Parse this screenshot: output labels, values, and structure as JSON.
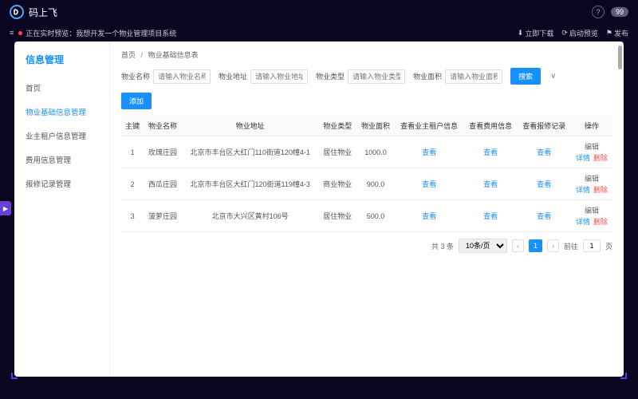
{
  "header": {
    "app_name": "码上飞",
    "help_glyph": "?",
    "user_badge": "99"
  },
  "subheader": {
    "menu_glyph": "≡",
    "live_label": "正在实时预览：",
    "live_text": "我想开发一个物业管理项目系统",
    "download": "立即下载",
    "preview": "启动预览",
    "publish": "发布"
  },
  "side_expand_glyph": "▶",
  "sidebar": {
    "title": "信息管理",
    "items": [
      "首页",
      "物业基础信息管理",
      "业主租户信息管理",
      "费用信息管理",
      "报修记录管理"
    ],
    "active_index": 1
  },
  "breadcrumb": {
    "home": "首页",
    "current": "物业基础信息表"
  },
  "filters": {
    "name_label": "物业名称",
    "name_ph": "请输入物业名称",
    "addr_label": "物业地址",
    "addr_ph": "请输入物业地址",
    "type_label": "物业类型",
    "type_ph": "请输入物业类型",
    "area_label": "物业面积",
    "area_ph": "请输入物业面积",
    "search_btn": "搜索",
    "expand_glyph": "∨"
  },
  "add_btn": "添加",
  "table": {
    "headers": [
      "主键",
      "物业名称",
      "物业地址",
      "物业类型",
      "物业面积",
      "查看业主租户信息",
      "查看费用信息",
      "查看报修记录",
      "操作"
    ],
    "view_label": "查看",
    "edit_label": "编辑",
    "detail_label": "详情",
    "delete_label": "删除",
    "rows": [
      {
        "id": "1",
        "name": "玫瑰庄园",
        "addr": "北京市丰台区大红门110街道120幢4-1",
        "type": "居住物业",
        "area": "1000.0"
      },
      {
        "id": "2",
        "name": "西瓜庄园",
        "addr": "北京市丰台区大红门120街道119幢4-3",
        "type": "商业物业",
        "area": "900.0"
      },
      {
        "id": "3",
        "name": "菠萝庄园",
        "addr": "北京市大兴区黄村106号",
        "type": "居住物业",
        "area": "500.0"
      }
    ]
  },
  "pagination": {
    "total": "共 3 条",
    "page_size": "10条/页",
    "prev": "‹",
    "next": "›",
    "current": "1",
    "goto_label": "前往",
    "goto_value": "1",
    "page_suffix": "页"
  }
}
